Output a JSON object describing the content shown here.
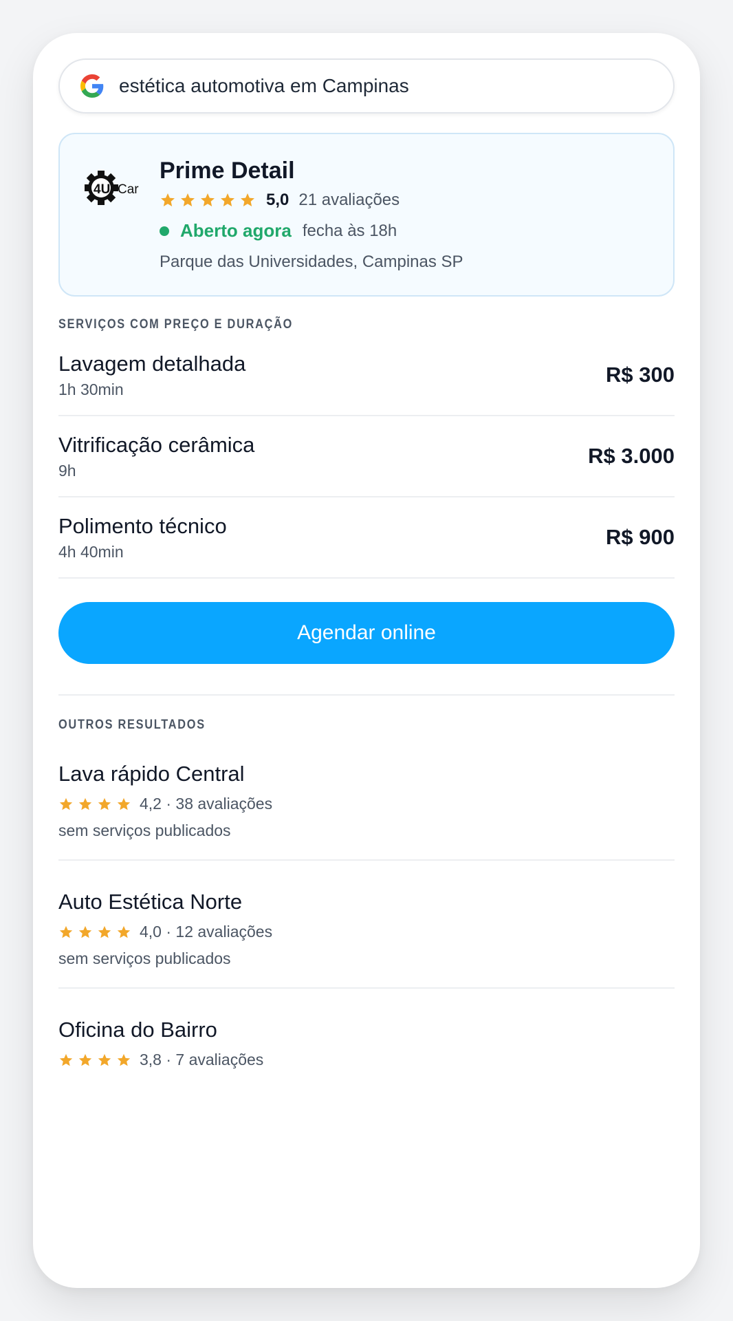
{
  "search": {
    "query": "estética automotiva em Campinas",
    "icon": "google-g-icon"
  },
  "featured": {
    "logo_text": "4UCar",
    "name": "Prime Detail",
    "rating": "5,0",
    "stars": 5,
    "reviews": "21 avaliações",
    "status": "Aberto agora",
    "closes": "fecha às 18h",
    "address": "Parque das Universidades, Campinas SP",
    "status_color": "#20a86b"
  },
  "services_title": "SERVIÇOS COM PREÇO E DURAÇÃO",
  "services": [
    {
      "name": "Lavagem detalhada",
      "duration": "1h 30min",
      "price": "R$ 300"
    },
    {
      "name": "Vitrificação cerâmica",
      "duration": "9h",
      "price": "R$ 3.000"
    },
    {
      "name": "Polimento técnico",
      "duration": "4h 40min",
      "price": "R$ 900"
    }
  ],
  "book_button": {
    "label": "Agendar online",
    "color": "#0aa6ff"
  },
  "others_title": "OUTROS RESULTADOS",
  "results": [
    {
      "name": "Lava rápido Central",
      "stars": 4,
      "rating_text": "4,2 · 38 avaliações",
      "note": "sem serviços publicados"
    },
    {
      "name": "Auto Estética Norte",
      "stars": 4,
      "rating_text": "4,0 · 12 avaliações",
      "note": "sem serviços publicados"
    },
    {
      "name": "Oficina do Bairro",
      "stars": 4,
      "rating_text": "3,8 · 7 avaliações"
    }
  ],
  "star_color": "#f2a72a"
}
